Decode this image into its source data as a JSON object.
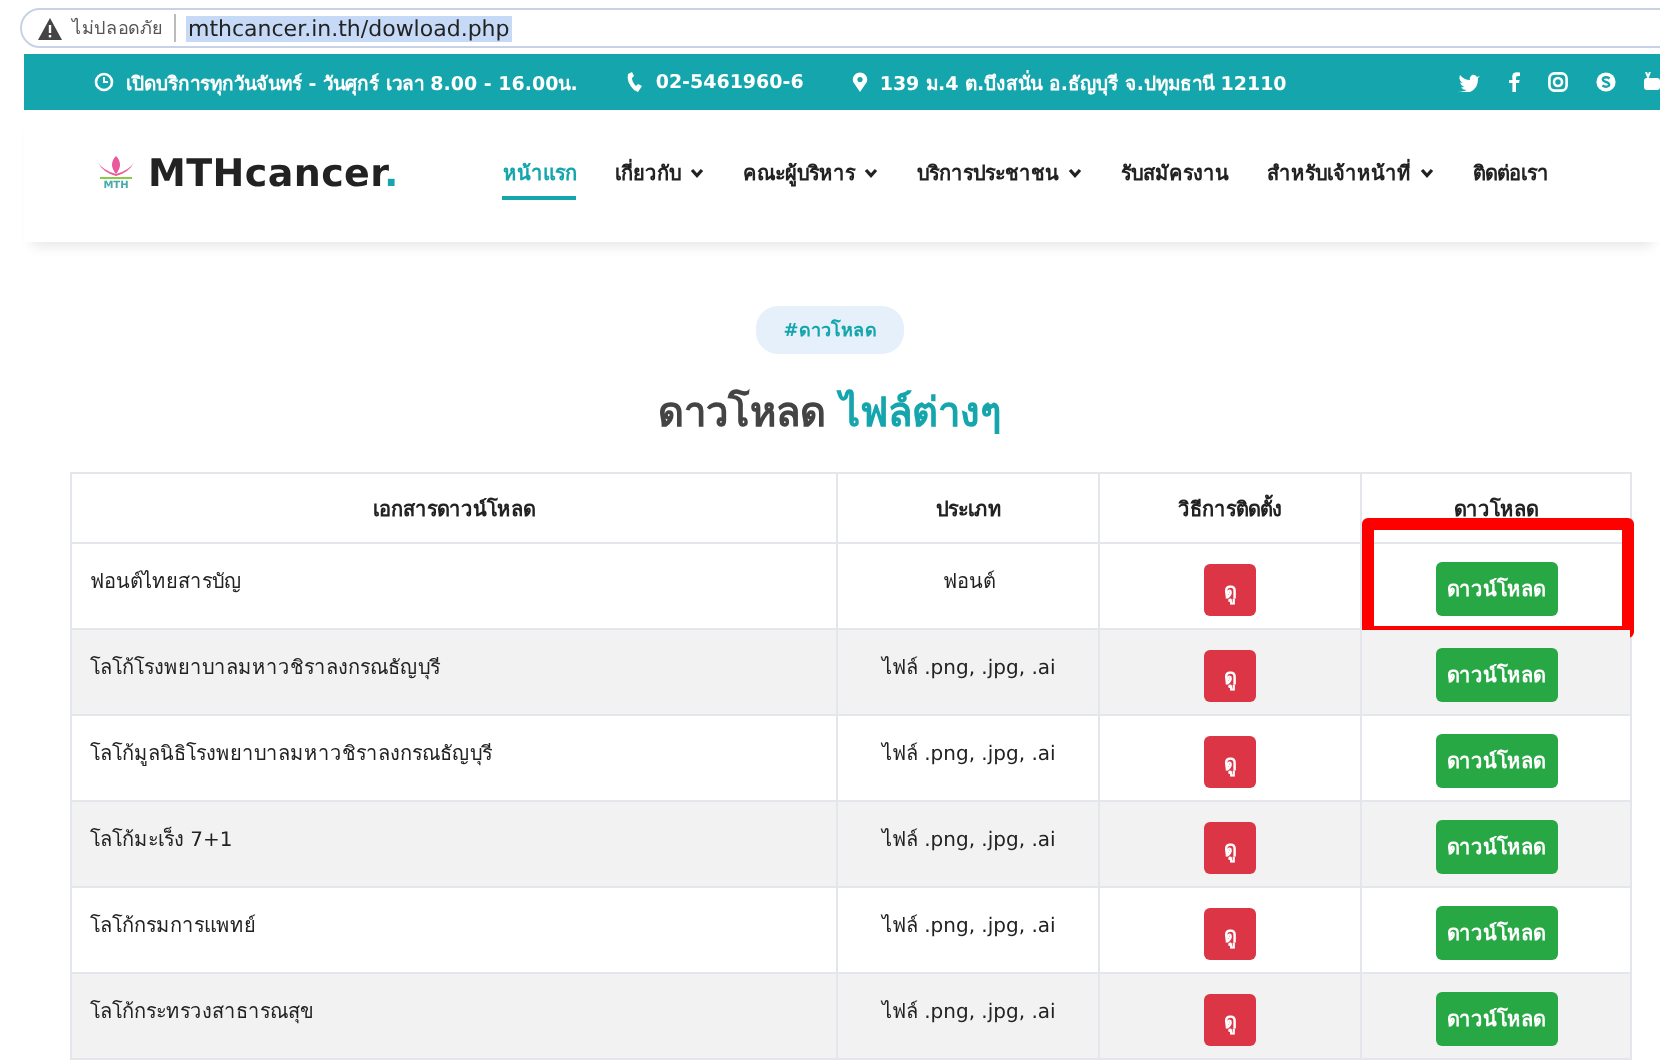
{
  "address_bar": {
    "security_label": "ไม่ปลอดภัย",
    "url": "mthcancer.in.th/dowload.php"
  },
  "info_bar": {
    "hours": "เปิดบริการทุกวันจันทร์ - วันศุกร์ เวลา 8.00 - 16.00น.",
    "phone": "02-5461960-6",
    "address": "139 ม.4 ต.บึงสนั่น อ.ธัญบุรี จ.ปทุมธานี 12110"
  },
  "header": {
    "logo_text": "MTHcancer",
    "logo_dot": ".",
    "logo_caption": "MTH"
  },
  "nav": [
    {
      "label": "หน้าแรก",
      "selected": true,
      "dropdown": false
    },
    {
      "label": "เกี่ยวกับ",
      "selected": false,
      "dropdown": true
    },
    {
      "label": "คณะผู้บริหาร",
      "selected": false,
      "dropdown": true
    },
    {
      "label": "บริการประชาชน",
      "selected": false,
      "dropdown": true
    },
    {
      "label": "รับสมัครงาน",
      "selected": false,
      "dropdown": false
    },
    {
      "label": "สำหรับเจ้าหน้าที่",
      "selected": false,
      "dropdown": true
    },
    {
      "label": "ติดต่อเรา",
      "selected": false,
      "dropdown": false
    }
  ],
  "section": {
    "tag": "#ดาวโหลด",
    "title": "ดาวโหลด",
    "title_accent": "ไฟล์ต่างๆ"
  },
  "table": {
    "columns": [
      "เอกสารดาวน์โหลด",
      "ประเภท",
      "วิธีการติดตั้ง",
      "ดาวโหลด"
    ],
    "rows": [
      {
        "name": "ฟอนต์ไทยสารบัญ",
        "type": "ฟอนต์",
        "view_button": "ดู",
        "download_button": "ดาวน์โหลด",
        "highlighted": true
      },
      {
        "name": "โลโก้โรงพยาบาลมหาวชิราลงกรณธัญบุรี",
        "type": "ไฟล์ .png, .jpg, .ai",
        "view_button": "ดู",
        "download_button": "ดาวน์โหลด",
        "highlighted": false
      },
      {
        "name": "โลโก้มูลนิธิโรงพยาบาลมหาวชิราลงกรณธัญบุรี",
        "type": "ไฟล์ .png, .jpg, .ai",
        "view_button": "ดู",
        "download_button": "ดาวน์โหลด",
        "highlighted": false
      },
      {
        "name": "โลโก้มะเร็ง 7+1",
        "type": "ไฟล์ .png, .jpg, .ai",
        "view_button": "ดู",
        "download_button": "ดาวน์โหลด",
        "highlighted": false
      },
      {
        "name": "โลโก้กรมการแพทย์",
        "type": "ไฟล์ .png, .jpg, .ai",
        "view_button": "ดู",
        "download_button": "ดาวน์โหลด",
        "highlighted": false
      },
      {
        "name": "โลโก้กระทรวงสาธารณสุข",
        "type": "ไฟล์ .png, .jpg, .ai",
        "view_button": "ดู",
        "download_button": "ดาวน์โหลด",
        "highlighted": false
      }
    ]
  }
}
